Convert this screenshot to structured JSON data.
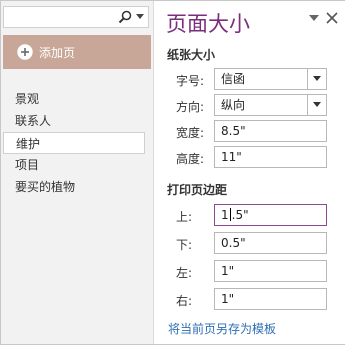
{
  "search": {
    "value": ""
  },
  "sidebar": {
    "add_page_label": "添加页",
    "items": [
      {
        "label": "景观"
      },
      {
        "label": "联系人"
      },
      {
        "label": "维护"
      },
      {
        "label": "项目"
      },
      {
        "label": "要买的植物"
      }
    ],
    "selected_index": 2
  },
  "pane": {
    "title": "页面大小",
    "paper_section": "纸张大小",
    "paper": {
      "size_label": "字号:",
      "size_value": "信函",
      "orientation_label": "方向:",
      "orientation_value": "纵向",
      "width_label": "宽度:",
      "width_value": "8.5\"",
      "height_label": "高度:",
      "height_value": "11\""
    },
    "margins_section": "打印页边距",
    "margins": {
      "top_label": "上:",
      "top_value_a": "1",
      "top_value_b": ".5\"",
      "bottom_label": "下:",
      "bottom_value": "0.5\"",
      "left_label": "左:",
      "left_value": "1\"",
      "right_label": "右:",
      "right_value": "1\""
    },
    "save_template_link": "将当前页另存为模板"
  },
  "colors": {
    "accent": "#7a2e7d",
    "selected_section": "#c9a798",
    "link": "#2e6fb3"
  },
  "icons": [
    "search-icon",
    "chevron-down-icon",
    "plus-circle-icon",
    "pin-icon",
    "close-icon"
  ]
}
